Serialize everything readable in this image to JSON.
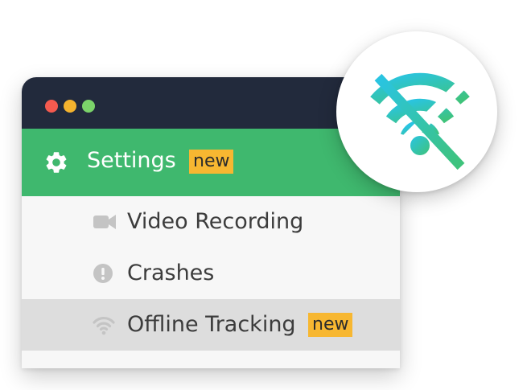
{
  "window": {
    "controls": [
      "close",
      "minimize",
      "maximize"
    ]
  },
  "settings": {
    "icon": "gear-icon",
    "label": "Settings",
    "badge": "new"
  },
  "menu": {
    "items": [
      {
        "icon": "video-camera-icon",
        "label": "Video Recording"
      },
      {
        "icon": "exclamation-circle-icon",
        "label": "Crashes"
      },
      {
        "icon": "wifi-icon",
        "label": "Offline Tracking",
        "badge": "new",
        "active": true
      }
    ]
  },
  "feature_badge": {
    "icon": "wifi-off-icon"
  },
  "colors": {
    "titlebar": "#222a3c",
    "settings_bar": "#3fb86e",
    "badge": "#f7b731",
    "active_row": "#dddddd",
    "menu_bg": "#f7f7f7",
    "gradient_start": "#29c4e3",
    "gradient_end": "#3fc37a"
  }
}
